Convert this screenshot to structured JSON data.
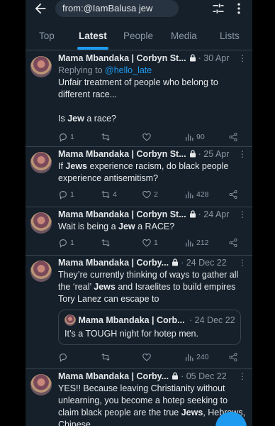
{
  "search": {
    "query": "from:@IamBalusa jew"
  },
  "tabs": [
    "Top",
    "Latest",
    "People",
    "Media",
    "Lists"
  ],
  "active_tab": "Latest",
  "colors": {
    "accent": "#1d9bf0",
    "background": "#15202b",
    "muted": "#8b98a5",
    "divider": "#38444d"
  },
  "icons": [
    "back-arrow-icon",
    "filter-icon",
    "more-vertical-icon",
    "lock-icon",
    "reply-icon",
    "retweet-icon",
    "like-icon",
    "views-icon",
    "share-icon",
    "compose-icon"
  ],
  "tweets": [
    {
      "name": "Mama Mbandaka | Corbyn St...",
      "date": "· 30 Apr",
      "replying_to_prefix": "Replying to",
      "replying_to": "@hello_late",
      "lines": [
        "Unfair treatment of people who belong to different race...",
        "Is Jew a race?"
      ],
      "replies": "1",
      "retweets": "",
      "likes": "",
      "views": "90"
    },
    {
      "name": "Mama Mbandaka | Corbyn St...",
      "date": "· 25 Apr",
      "lines": [
        "If Jews experience racism, do black people experience antisemitism?"
      ],
      "replies": "1",
      "retweets": "4",
      "likes": "2",
      "views": "428"
    },
    {
      "name": "Mama Mbandaka | Corbyn St...",
      "date": "· 24 Apr",
      "lines": [
        "Wait is being a Jew a RACE?"
      ],
      "replies": "1",
      "retweets": "",
      "likes": "1",
      "views": "212"
    },
    {
      "name": "Mama Mbandaka | Corby...",
      "date": "· 24 Dec 22",
      "lines": [
        "They’re currently thinking of ways to gather all the ‘real’ Jews and Israelites to build empires Tory Lanez can escape to"
      ],
      "quote": {
        "name": "Mama Mbandaka | Corb...",
        "date": "· 24 Dec 22",
        "text": "It’s a TOUGH night for hotep men."
      },
      "replies": "",
      "retweets": "",
      "likes": "",
      "views": "240"
    },
    {
      "name": "Mama Mbandaka | Corby...",
      "date": "· 05 Dec 22",
      "lines": [
        "YES!! Because leaving Christianity without unlearning, you become a hotep seeking to claim black people are the true Jews, Hebrews, Chinese"
      ]
    }
  ]
}
